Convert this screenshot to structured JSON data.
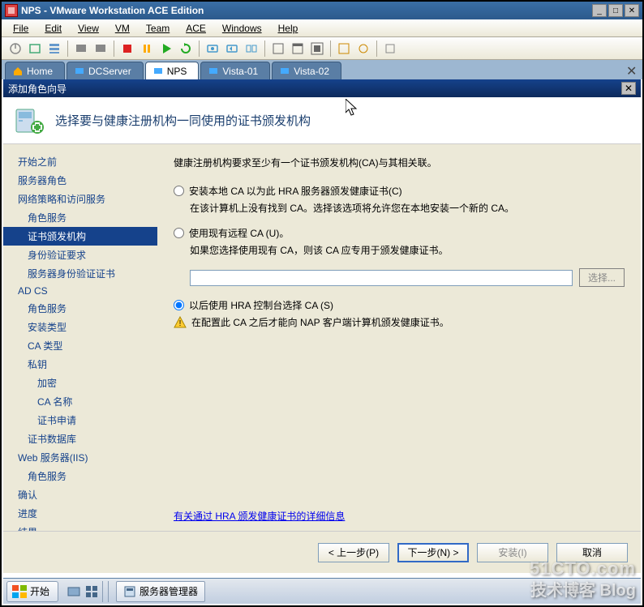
{
  "vm": {
    "title": "NPS - VMware Workstation ACE Edition",
    "menu": [
      "File",
      "Edit",
      "View",
      "VM",
      "Team",
      "ACE",
      "Windows",
      "Help"
    ],
    "tabs": [
      {
        "label": "Home",
        "active": false,
        "icon": "home"
      },
      {
        "label": "DCServer",
        "active": false,
        "icon": "vm"
      },
      {
        "label": "NPS",
        "active": true,
        "icon": "vm"
      },
      {
        "label": "Vista-01",
        "active": false,
        "icon": "vm"
      },
      {
        "label": "Vista-02",
        "active": false,
        "icon": "vm"
      }
    ]
  },
  "wizard": {
    "window_title": "添加角色向导",
    "header_title": "选择要与健康注册机构一同使用的证书颁发机构",
    "nav": [
      {
        "label": "开始之前",
        "lvl": 0
      },
      {
        "label": "服务器角色",
        "lvl": 0
      },
      {
        "label": "网络策略和访问服务",
        "lvl": 0
      },
      {
        "label": "角色服务",
        "lvl": 1
      },
      {
        "label": "证书颁发机构",
        "lvl": 1,
        "selected": true
      },
      {
        "label": "身份验证要求",
        "lvl": 1
      },
      {
        "label": "服务器身份验证证书",
        "lvl": 1
      },
      {
        "label": "AD CS",
        "lvl": 0
      },
      {
        "label": "角色服务",
        "lvl": 1
      },
      {
        "label": "安装类型",
        "lvl": 1
      },
      {
        "label": "CA 类型",
        "lvl": 1
      },
      {
        "label": "私钥",
        "lvl": 1
      },
      {
        "label": "加密",
        "lvl": 2
      },
      {
        "label": "CA 名称",
        "lvl": 2
      },
      {
        "label": "证书申请",
        "lvl": 2
      },
      {
        "label": "证书数据库",
        "lvl": 1
      },
      {
        "label": "Web 服务器(IIS)",
        "lvl": 0
      },
      {
        "label": "角色服务",
        "lvl": 1
      },
      {
        "label": "确认",
        "lvl": 0
      },
      {
        "label": "进度",
        "lvl": 0
      },
      {
        "label": "结果",
        "lvl": 0
      }
    ],
    "intro": "健康注册机构要求至少有一个证书颁发机构(CA)与其相关联。",
    "opt1_label": "安装本地 CA 以为此 HRA 服务器颁发健康证书(C)",
    "opt1_desc": "在该计算机上没有找到 CA。选择该选项将允许您在本地安装一个新的 CA。",
    "opt2_label": "使用现有远程 CA (U)。",
    "opt2_desc": "如果您选择使用现有 CA，则该 CA 应专用于颁发健康证书。",
    "browse_btn": "选择...",
    "opt3_label": "以后使用 HRA 控制台选择 CA (S)",
    "warn_text": "在配置此 CA 之后才能向 NAP 客户端计算机颁发健康证书。",
    "link_text": "有关通过 HRA 颁发健康证书的详细信息",
    "btn_prev": "< 上一步(P)",
    "btn_next": "下一步(N) >",
    "btn_install": "安装(I)",
    "btn_cancel": "取消"
  },
  "taskbar": {
    "start": "开始",
    "task1": "服务器管理器"
  },
  "watermark": {
    "line1": "51CTO.com",
    "line2": "技术博客 Blog"
  }
}
